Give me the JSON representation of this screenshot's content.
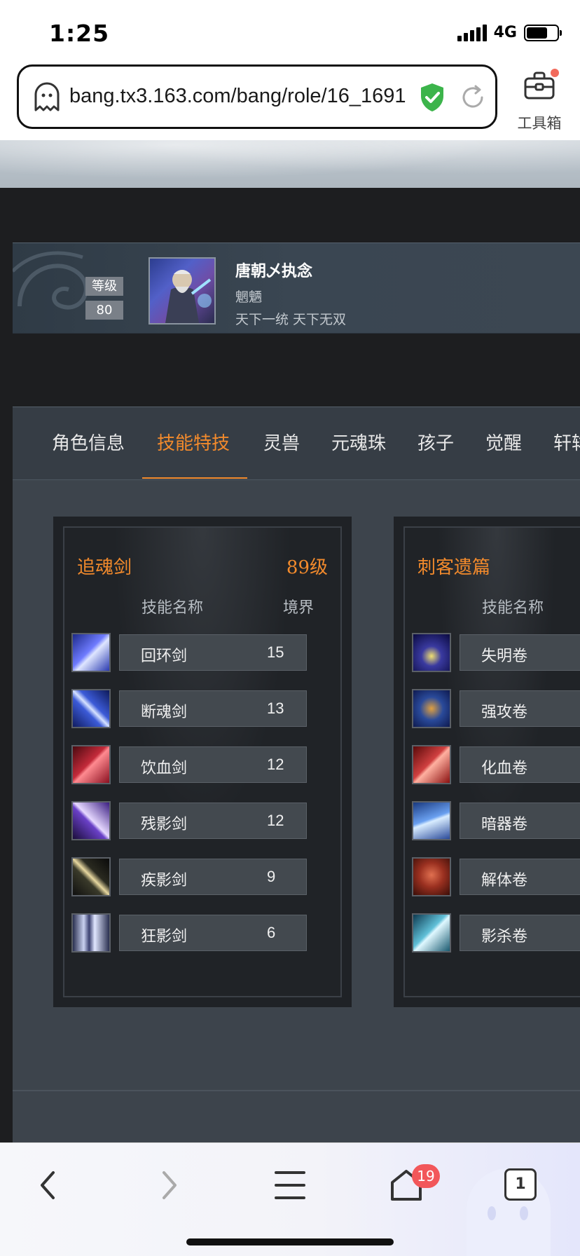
{
  "status_bar": {
    "time": "1:25",
    "network": "4G"
  },
  "browser": {
    "url": "bang.tx3.163.com/bang/role/16_1691",
    "toolbox_label": "工具箱"
  },
  "role": {
    "level_label": "等级",
    "level_value": "80",
    "name": "唐朝乄执念",
    "class": "魍魉",
    "motto": "天下一统 天下无双"
  },
  "tabs": [
    "角色信息",
    "技能特技",
    "灵兽",
    "元魂珠",
    "孩子",
    "觉醒",
    "轩辕"
  ],
  "active_tab": "技能特技",
  "skill_sets": [
    {
      "title": "追魂剑",
      "level": "89级",
      "col_name": "技能名称",
      "col_value": "境界",
      "skills": [
        {
          "name": "回环剑",
          "value": "15",
          "icon": "blade-swirl-icon"
        },
        {
          "name": "断魂剑",
          "value": "13",
          "icon": "sword-strike-icon"
        },
        {
          "name": "饮血剑",
          "value": "12",
          "icon": "blood-claw-icon"
        },
        {
          "name": "残影剑",
          "value": "12",
          "icon": "shadow-blade-icon"
        },
        {
          "name": "疾影剑",
          "value": "9",
          "icon": "quick-blade-icon"
        },
        {
          "name": "狂影剑",
          "value": "6",
          "icon": "frenzy-blades-icon"
        }
      ]
    },
    {
      "title": "刺客遗篇",
      "level": "",
      "col_name": "技能名称",
      "col_value": "",
      "skills": [
        {
          "name": "失明卷",
          "value": "",
          "icon": "blind-scroll-icon"
        },
        {
          "name": "强攻卷",
          "value": "",
          "icon": "assault-scroll-icon"
        },
        {
          "name": "化血卷",
          "value": "",
          "icon": "blood-scroll-icon"
        },
        {
          "name": "暗器卷",
          "value": "",
          "icon": "hidden-weapon-scroll-icon"
        },
        {
          "name": "解体卷",
          "value": "",
          "icon": "dismember-scroll-icon"
        },
        {
          "name": "影杀卷",
          "value": "",
          "icon": "shadow-kill-scroll-icon"
        }
      ]
    }
  ],
  "bottom_nav": {
    "home_badge": "19",
    "tab_count": "1"
  },
  "colors": {
    "accent": "#f28a2c",
    "panel": "#3d444c",
    "badge": "#f2575a",
    "shield": "#3cb44b"
  }
}
